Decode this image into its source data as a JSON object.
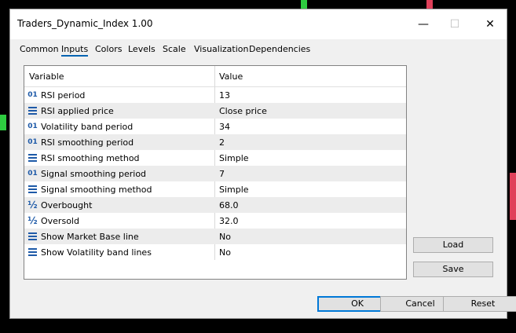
{
  "window": {
    "title": "Traders_Dynamic_Index 1.00"
  },
  "titlebar": {
    "minimize": "—",
    "maximize": "☐",
    "close": "✕"
  },
  "tabs": [
    "Common",
    "Inputs",
    "Colors",
    "Levels",
    "Scale",
    "Visualization",
    "Dependencies"
  ],
  "active_tab": "Inputs",
  "table": {
    "headers": {
      "variable": "Variable",
      "value": "Value"
    },
    "rows": [
      {
        "icon": "int",
        "name": "RSI period",
        "value": "13"
      },
      {
        "icon": "enum",
        "name": "RSI applied price",
        "value": "Close price"
      },
      {
        "icon": "int",
        "name": "Volatility band period",
        "value": "34"
      },
      {
        "icon": "int",
        "name": "RSI smoothing period",
        "value": "2"
      },
      {
        "icon": "enum",
        "name": "RSI smoothing method",
        "value": "Simple"
      },
      {
        "icon": "int",
        "name": "Signal smoothing period",
        "value": "7"
      },
      {
        "icon": "enum",
        "name": "Signal smoothing method",
        "value": "Simple"
      },
      {
        "icon": "double",
        "name": "Overbought",
        "value": "68.0"
      },
      {
        "icon": "double",
        "name": "Oversold",
        "value": "32.0"
      },
      {
        "icon": "enum",
        "name": "Show Market Base line",
        "value": "No"
      },
      {
        "icon": "enum",
        "name": "Show Volatility band lines",
        "value": "No"
      }
    ]
  },
  "side_buttons": {
    "load": "Load",
    "save": "Save"
  },
  "footer_buttons": {
    "ok": "OK",
    "cancel": "Cancel",
    "reset": "Reset"
  },
  "colors": {
    "accent": "#0078d7",
    "candle_up": "#2ecc40",
    "candle_down": "#e0405a"
  }
}
